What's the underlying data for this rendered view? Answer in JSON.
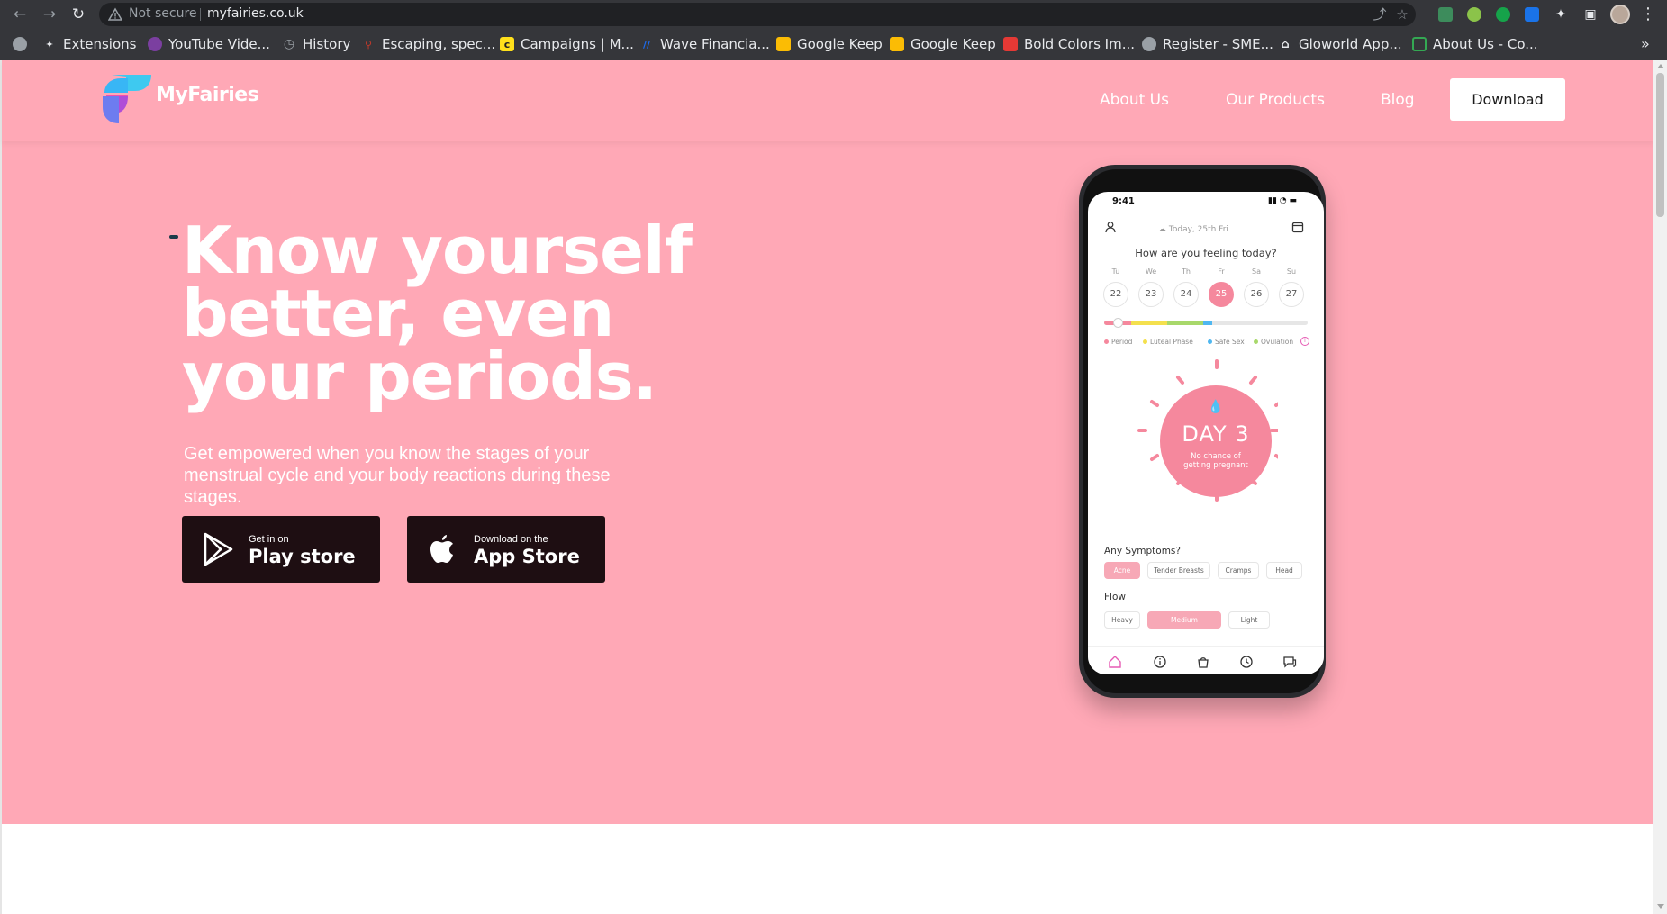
{
  "browser": {
    "security_label": "Not secure",
    "url": "myfairies.co.uk",
    "bookmarks": [
      {
        "label": "Extensions",
        "icon": "puzzle-icon",
        "color": "#9aa0a6"
      },
      {
        "label": "YouTube Vide...",
        "icon": "paw-icon",
        "color": "#7b3fa0"
      },
      {
        "label": "History",
        "icon": "history-icon",
        "color": "#9aa0a6"
      },
      {
        "label": "Escaping, spec...",
        "icon": "figure-icon",
        "color": "#c0392b"
      },
      {
        "label": "Campaigns | M...",
        "icon": "mailchimp-icon",
        "color": "#ffe01b"
      },
      {
        "label": "Wave Financia...",
        "icon": "wave-icon",
        "color": "#1c6cf2"
      },
      {
        "label": "Google Keep",
        "icon": "keep-icon",
        "color": "#fbbc04"
      },
      {
        "label": "Google Keep",
        "icon": "keep-icon",
        "color": "#fbbc04"
      },
      {
        "label": "Bold Colors Im...",
        "icon": "bold-icon",
        "color": "#e53935"
      },
      {
        "label": "Register - SME...",
        "icon": "globe-icon",
        "color": "#9aa0a6"
      },
      {
        "label": "Gloworld App...",
        "icon": "house-icon",
        "color": "#9aa0a6"
      },
      {
        "label": "About Us - Co...",
        "icon": "bot-icon",
        "color": "#34a853"
      }
    ]
  },
  "site": {
    "brand": "MyFairies",
    "nav": {
      "about": "About Us",
      "products": "Our Products",
      "blog": "Blog",
      "download": "Download"
    },
    "hero": {
      "headline_1": "Know yourself",
      "headline_2": "better, even",
      "headline_3": "your periods.",
      "subtext": "Get empowered when you know the stages of your menstrual cycle and your body reactions during these stages."
    },
    "play_store": {
      "small": "Get in on",
      "big": "Play store"
    },
    "app_store": {
      "small": "Download on the",
      "big": "App Store"
    },
    "colors": {
      "hero_bg": "#ffa8b6",
      "button_dark": "#1e0e12",
      "accent": "#f5889d"
    }
  },
  "app": {
    "time": "9:41",
    "date": "Today, 25th Fri",
    "question": "How are you feeling today?",
    "days": [
      {
        "label": "Tu",
        "num": "22"
      },
      {
        "label": "We",
        "num": "23"
      },
      {
        "label": "Th",
        "num": "24"
      },
      {
        "label": "Fr",
        "num": "25"
      },
      {
        "label": "Sa",
        "num": "26"
      },
      {
        "label": "Su",
        "num": "27"
      }
    ],
    "legend": {
      "period": "Period",
      "luteal": "Luteal Phase",
      "safe": "Safe Sex",
      "ovulation": "Ovulation"
    },
    "day_title": "DAY 3",
    "day_note": "No chance of getting pregnant",
    "symptoms_label": "Any Symptoms?",
    "symptoms": [
      "Acne",
      "Tender Breasts",
      "Cramps",
      "Head"
    ],
    "flow_label": "Flow",
    "flow": [
      "Heavy",
      "Medium",
      "Light"
    ]
  }
}
